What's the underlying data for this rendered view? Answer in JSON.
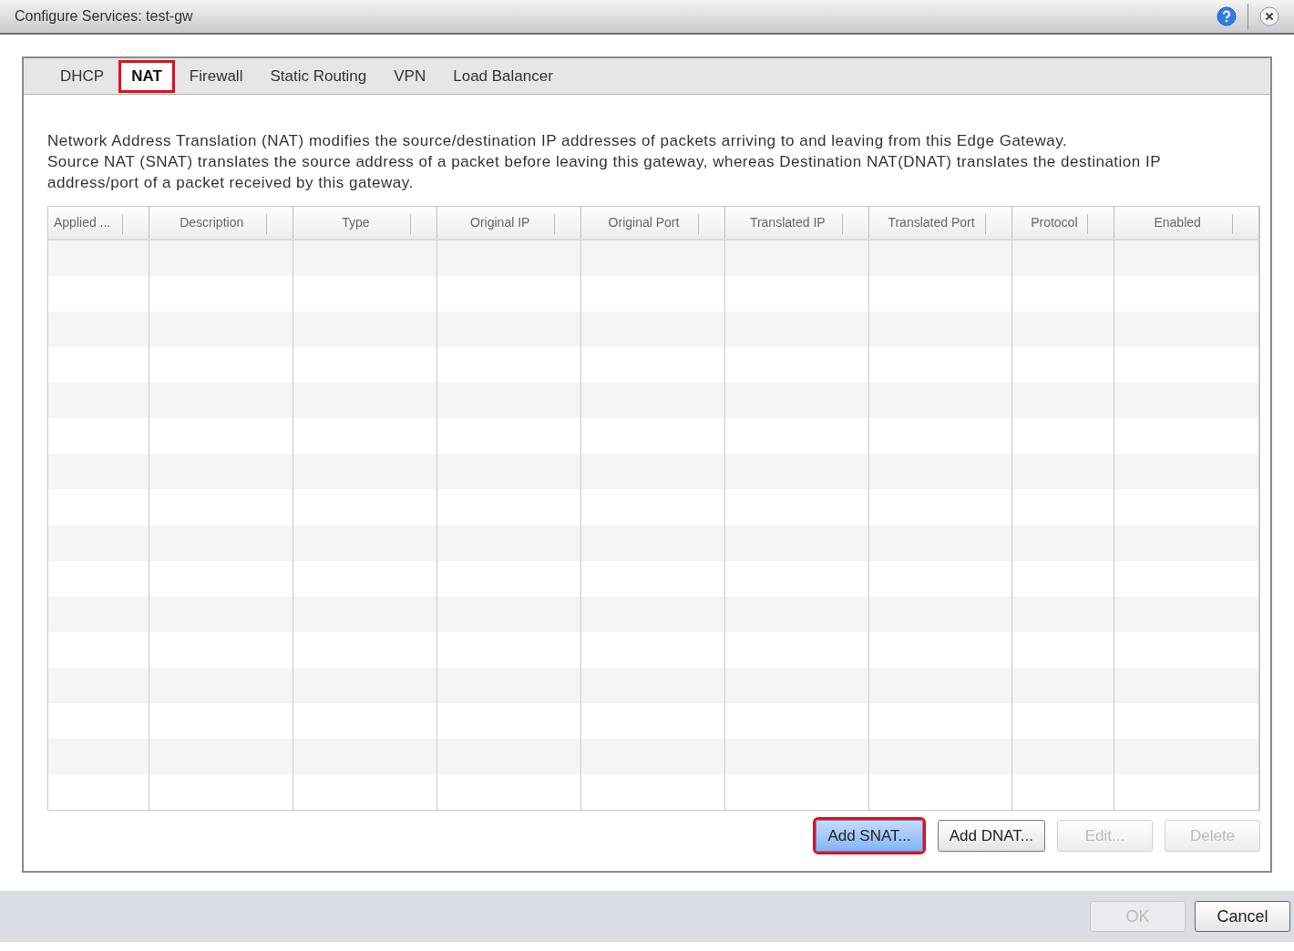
{
  "window": {
    "title": "Configure Services: test-gw"
  },
  "tabs": [
    {
      "label": "DHCP",
      "selected": false,
      "highlighted": false
    },
    {
      "label": "NAT",
      "selected": true,
      "highlighted": true
    },
    {
      "label": "Firewall",
      "selected": false,
      "highlighted": false
    },
    {
      "label": "Static Routing",
      "selected": false,
      "highlighted": false
    },
    {
      "label": "VPN",
      "selected": false,
      "highlighted": false
    },
    {
      "label": "Load Balancer",
      "selected": false,
      "highlighted": false
    }
  ],
  "description": [
    "Network Address Translation (NAT) modifies the source/destination IP addresses of packets arriving to and leaving from this Edge Gateway.",
    "Source NAT (SNAT) translates the source address of a packet before leaving this gateway, whereas Destination NAT(DNAT)  translates the destination IP address/port of a packet received by this gateway."
  ],
  "table": {
    "columns": [
      "Applied ...",
      "Description",
      "Type",
      "Original IP",
      "Original Port",
      "Translated IP",
      "Translated Port",
      "Protocol",
      "Enabled"
    ]
  },
  "actions": [
    {
      "label": "Add SNAT...",
      "disabled": false,
      "highlighted": true,
      "selected": true
    },
    {
      "label": "Add DNAT...",
      "disabled": false,
      "highlighted": false,
      "selected": false
    },
    {
      "label": "Edit...",
      "disabled": true,
      "highlighted": false,
      "selected": false
    },
    {
      "label": "Delete",
      "disabled": true,
      "highlighted": false,
      "selected": false
    }
  ],
  "footer": [
    {
      "label": "OK",
      "disabled": true
    },
    {
      "label": "Cancel",
      "disabled": false
    }
  ]
}
